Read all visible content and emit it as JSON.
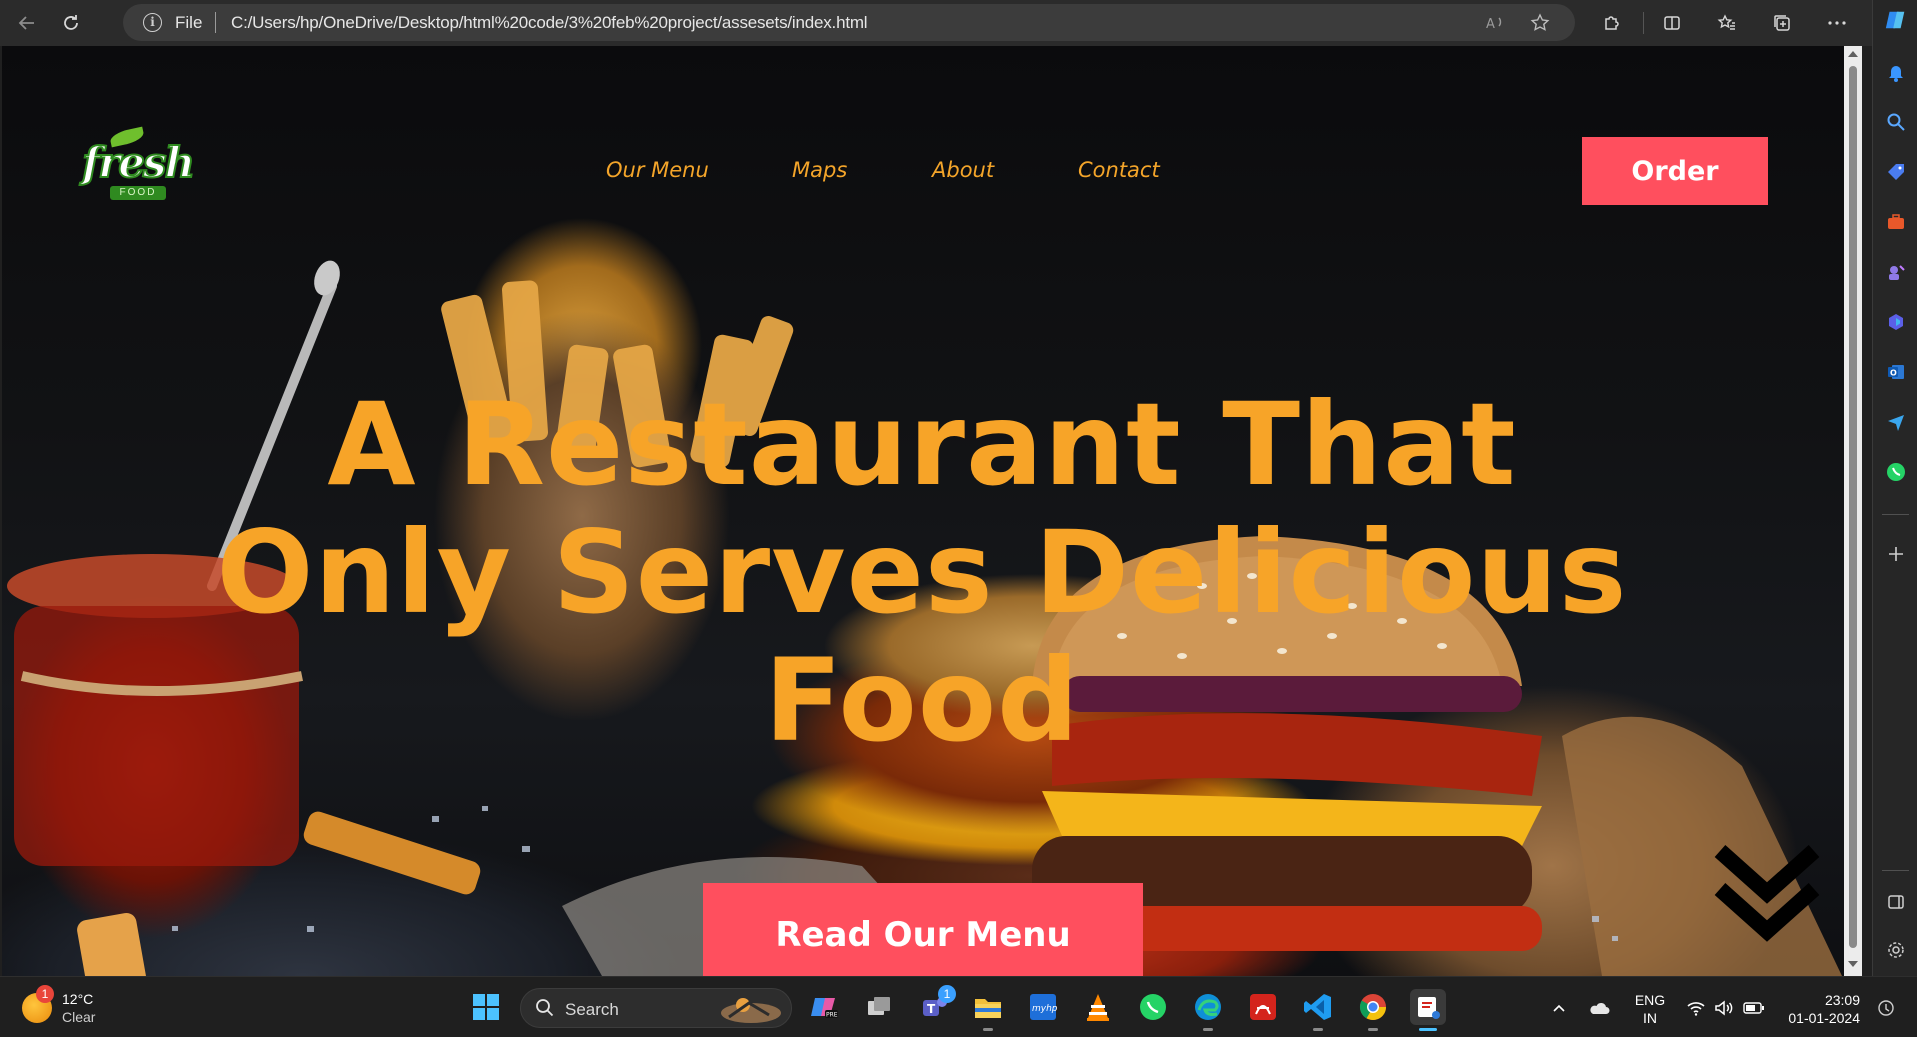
{
  "browser": {
    "address_scheme": "File",
    "url": "C:/Users/hp/OneDrive/Desktop/html%20code/3%20feb%20project/assesets/index.html"
  },
  "site": {
    "logo": {
      "word": "fresh",
      "sub": "FOOD"
    },
    "nav": [
      {
        "label": "Our Menu"
      },
      {
        "label": "Maps"
      },
      {
        "label": "About"
      },
      {
        "label": "Contact"
      }
    ],
    "order_label": "Order",
    "hero_heading": "A Restaurant That Only Serves Delicious Food",
    "cta_label": "Read Our Menu",
    "colors": {
      "accent_red": "#ff4f5e",
      "heading_orange": "#f7a428",
      "nav_orange": "#f4a52a"
    }
  },
  "taskbar": {
    "weather": {
      "temp": "12°C",
      "desc": "Clear",
      "badge": "1"
    },
    "search_placeholder": "Search",
    "teams_badge": "1",
    "language": {
      "line1": "ENG",
      "line2": "IN"
    },
    "clock": {
      "time": "23:09",
      "date": "01-01-2024"
    }
  }
}
